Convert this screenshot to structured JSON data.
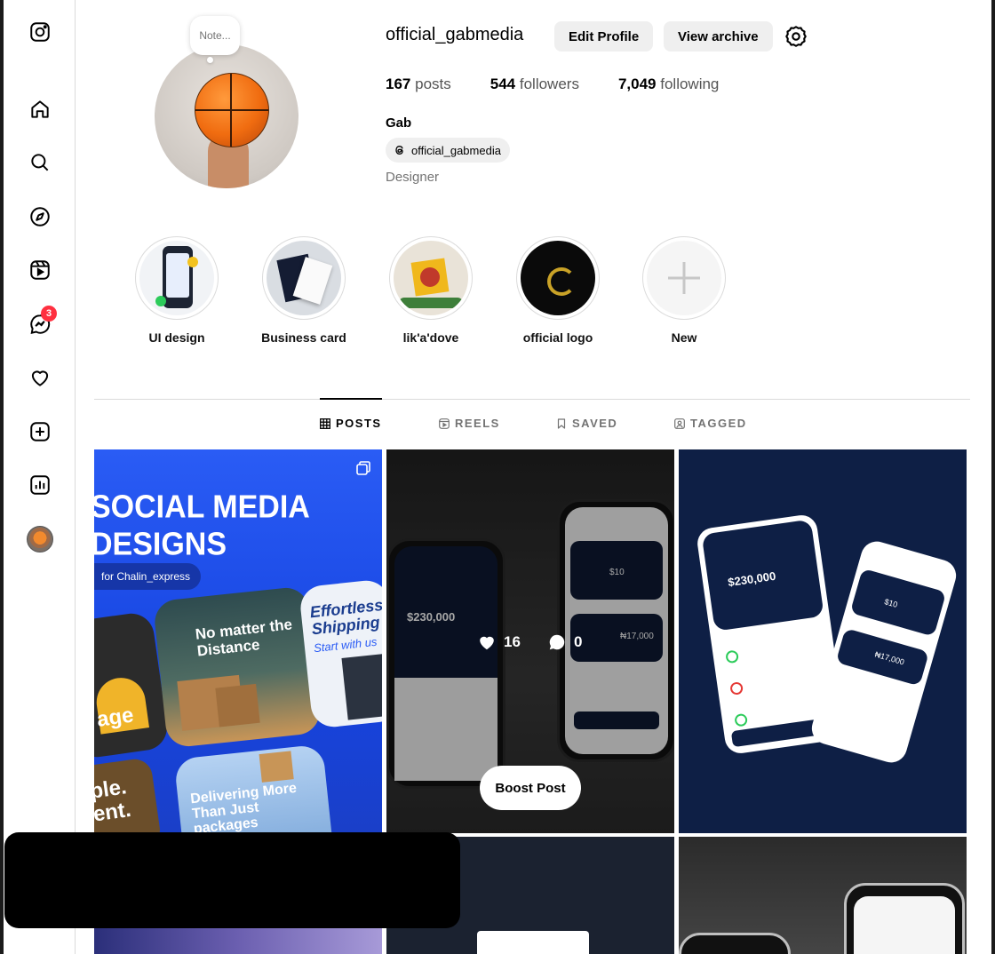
{
  "sidebar": {
    "items": [
      {
        "name": "instagram-logo",
        "label": "Instagram"
      },
      {
        "name": "home",
        "label": "Home"
      },
      {
        "name": "search",
        "label": "Search"
      },
      {
        "name": "explore",
        "label": "Explore"
      },
      {
        "name": "reels",
        "label": "Reels"
      },
      {
        "name": "messages",
        "label": "Messages",
        "badge": "3"
      },
      {
        "name": "notifications",
        "label": "Notifications"
      },
      {
        "name": "create",
        "label": "Create"
      },
      {
        "name": "dashboard",
        "label": "Dashboard"
      },
      {
        "name": "profile",
        "label": "Profile"
      }
    ]
  },
  "profile": {
    "note": "Note...",
    "username": "official_gabmedia",
    "edit_profile_label": "Edit Profile",
    "view_archive_label": "View archive",
    "stats": {
      "posts_count": "167",
      "posts_label": "posts",
      "followers_count": "544",
      "followers_label": "followers",
      "following_count": "7,049",
      "following_label": "following"
    },
    "full_name": "Gab",
    "threads_handle": "official_gabmedia",
    "bio": "Designer"
  },
  "highlights": [
    {
      "label": "UI design"
    },
    {
      "label": "Business card"
    },
    {
      "label": "lik'a'dove"
    },
    {
      "label": "official logo"
    },
    {
      "label": "New"
    }
  ],
  "tabs": [
    {
      "label": "POSTS",
      "active": true
    },
    {
      "label": "REELS",
      "active": false
    },
    {
      "label": "SAVED",
      "active": false
    },
    {
      "label": "TAGGED",
      "active": false
    }
  ],
  "posts": [
    {
      "title_line1": "SOCIAL MEDIA",
      "title_line2": "DESIGNS",
      "tag": "for Chalin_express",
      "card1": "No matter the Distance",
      "card2": "Effortless Shipping",
      "card2_sub": "Start with us",
      "card3": "Delivering More Than Just packages",
      "fragment1": "age",
      "fragment2": "ple.",
      "fragment3": "ent."
    },
    {
      "likes": "16",
      "comments": "0",
      "amount": "$230,000",
      "boost_label": "Boost Post",
      "right_phone_amount": "₦17,000",
      "right_phone_small": "$10"
    },
    {
      "amount": "$230,000",
      "right_amount": "₦17,000",
      "right_small": "$10"
    }
  ],
  "colors": {
    "accent_blue": "#1a4ff0",
    "badge_red": "#ff3040",
    "dark_navy": "#0e1f45"
  }
}
